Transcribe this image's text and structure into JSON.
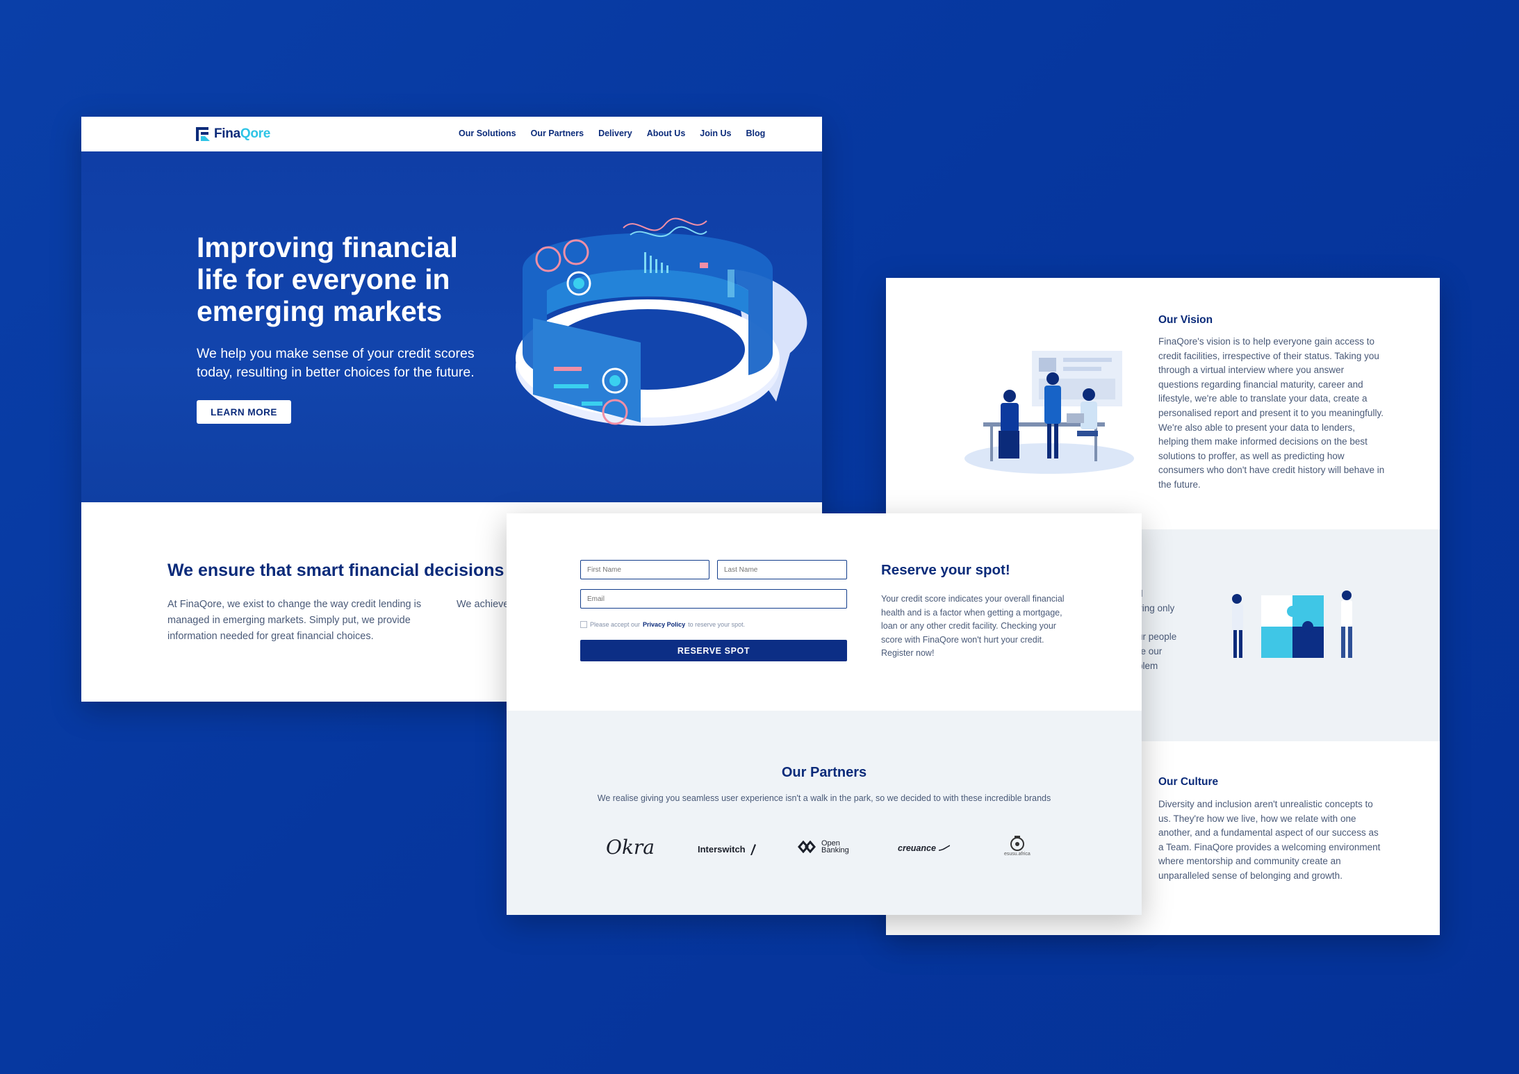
{
  "colors": {
    "background": "#0a3fa8",
    "navy": "#0b2b7a",
    "accent": "#2ec4e6",
    "muted": "#4a5a78",
    "light_section": "#eef2f6"
  },
  "home": {
    "brand": {
      "name_part1": "Fina",
      "name_part2": "Qore"
    },
    "nav": [
      "Our Solutions",
      "Our Partners",
      "Delivery",
      "About Us",
      "Join Us",
      "Blog"
    ],
    "hero": {
      "title": "Improving financial life for everyone in emerging markets",
      "subtitle": "We help you make sense of your credit scores today, resulting in better choices for the future.",
      "button": "LEARN MORE"
    },
    "smart": {
      "heading": "We ensure that smart financial decisions a",
      "col1": "At FinaQore, we exist to change the way credit lending is managed in emerging markets. Simply put, we provide information needed for great financial choices.",
      "col2": "We achieve that can be credits and"
    }
  },
  "about": {
    "vision": {
      "heading": "Our Vision",
      "text": "FinaQore's vision is to help everyone gain access to credit facilities, irrespective of their status. Taking you through a virtual interview where you answer questions regarding financial maturity, career and lifestyle, we're able to translate your data, create a personalised report and present it to you meaningfully. We're also able to present your data to lenders, helping them make informed decisions on the best solutions to proffer, as well as predicting how consumers who don't have credit history will behave in the future."
    },
    "mission_fragments": [
      "d",
      "ving only",
      "ur people",
      "re our",
      "blem"
    ],
    "culture": {
      "heading": "Our Culture",
      "text": "Diversity and inclusion aren't unrealistic concepts to us. They're how we live, how we relate with one another, and a fundamental aspect of our success as a Team. FinaQore provides a welcoming environment where mentorship and community create an unparalleled sense of belonging and growth."
    }
  },
  "reserve": {
    "first_name_placeholder": "First Name",
    "last_name_placeholder": "Last Name",
    "email_placeholder": "Email",
    "consent_before": "Please accept our",
    "consent_link": "Privacy Policy",
    "consent_after": "to reserve your spot.",
    "button": "RESERVE SPOT",
    "heading": "Reserve your spot!",
    "text": "Your credit score indicates your overall financial health and is a factor when getting a mortgage, loan or any other credit facility. Checking your score with FinaQore won't hurt your credit. Register now!"
  },
  "partners": {
    "heading": "Our Partners",
    "subtitle": "We realise giving you seamless user experience isn't a walk in the park, so we decided to with these incredible brands",
    "logos": [
      "Okra",
      "Interswitch",
      "Open Banking",
      "creuance",
      "esusu.africa"
    ]
  }
}
